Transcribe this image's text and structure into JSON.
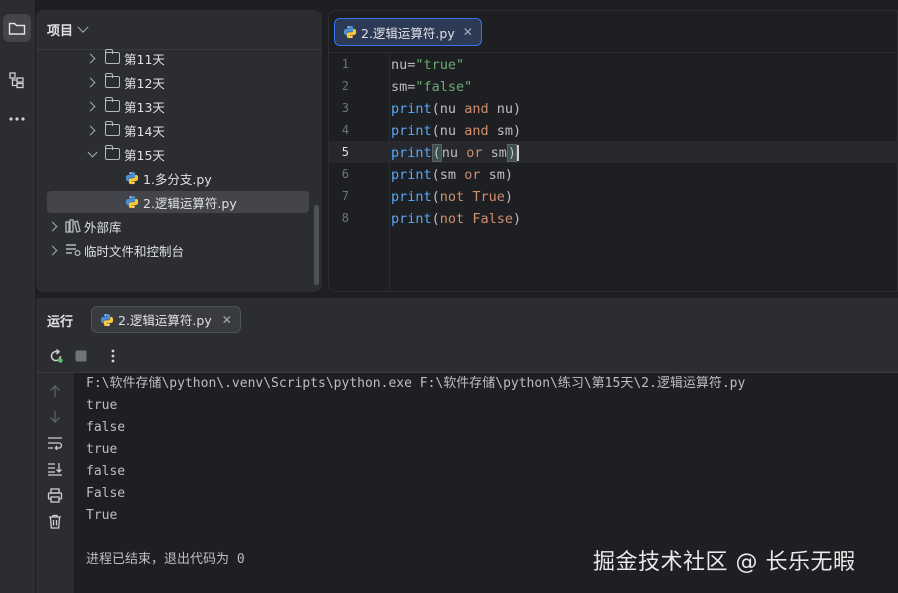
{
  "project_panel": {
    "title": "项目",
    "items": [
      {
        "label": "第11天",
        "kind": "folder",
        "expanded": false
      },
      {
        "label": "第12天",
        "kind": "folder",
        "expanded": false
      },
      {
        "label": "第13天",
        "kind": "folder",
        "expanded": false
      },
      {
        "label": "第14天",
        "kind": "folder",
        "expanded": false
      },
      {
        "label": "第15天",
        "kind": "folder",
        "expanded": true
      },
      {
        "label": "1.多分支.py",
        "kind": "python-file"
      },
      {
        "label": "2.逻辑运算符.py",
        "kind": "python-file",
        "selected": true
      },
      {
        "label": "外部库",
        "kind": "library"
      },
      {
        "label": "临时文件和控制台",
        "kind": "scratches"
      }
    ]
  },
  "editor": {
    "tab_label": "2.逻辑运算符.py",
    "current_line": 5,
    "line_numbers": [
      "1",
      "2",
      "3",
      "4",
      "5",
      "6",
      "7",
      "8"
    ],
    "lines": [
      "nu=\"true\"",
      "sm=\"false\"",
      "print(nu and nu)",
      "print(nu and sm)",
      "print(nu or sm)",
      "print(sm or sm)",
      "print(not True)",
      "print(not False)"
    ]
  },
  "run_panel": {
    "title": "运行",
    "tab_label": "2.逻辑运算符.py",
    "output": [
      "F:\\软件存储\\python\\.venv\\Scripts\\python.exe F:\\软件存储\\python\\练习\\第15天\\2.逻辑运算符.py",
      "true",
      "false",
      "true",
      "false",
      "False",
      "True",
      "",
      "进程已结束，退出代码为 0"
    ]
  },
  "watermark": "掘金技术社区 @ 长乐无暇",
  "colors": {
    "background": "#1e1f22",
    "panel": "#2b2d30",
    "accent": "#3574f0",
    "function": "#56a8f5",
    "keyword": "#cf8e6d",
    "string": "#6aab73"
  }
}
